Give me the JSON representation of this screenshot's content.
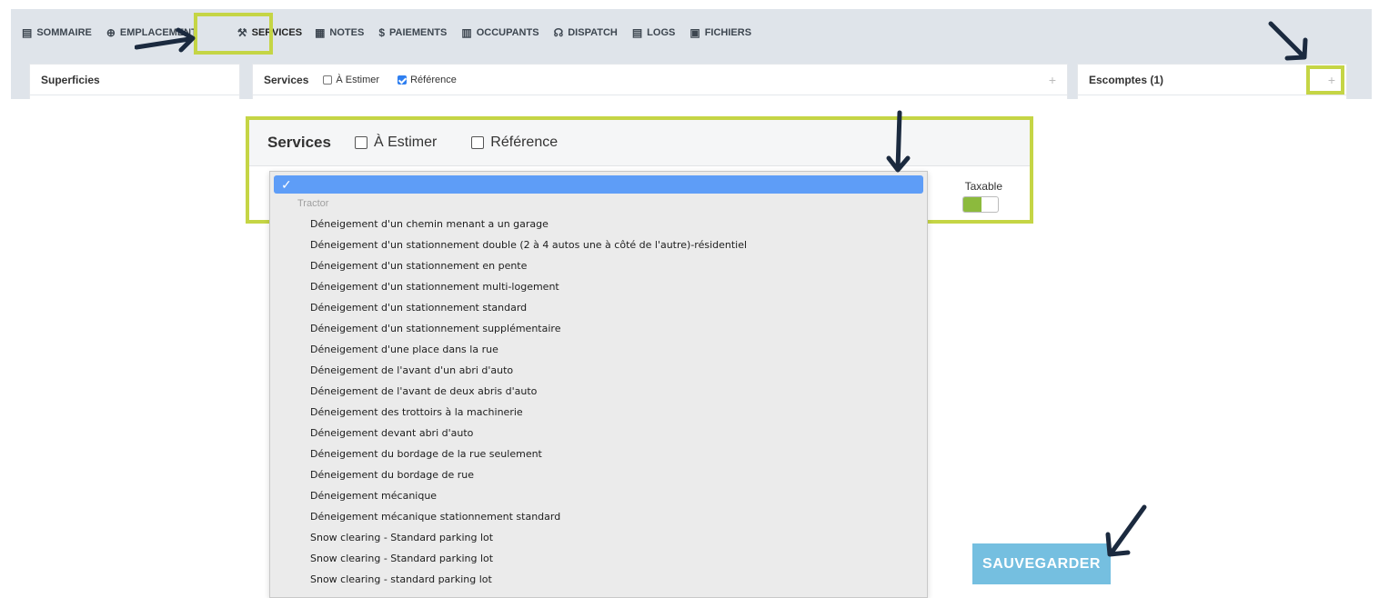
{
  "nav": {
    "items": [
      {
        "label": "SOMMAIRE",
        "icon": "document-icon"
      },
      {
        "label": "EMPLACEMENT",
        "icon": "crosshair-icon"
      },
      {
        "label": "SERVICES",
        "icon": "tools-icon"
      },
      {
        "label": "NOTES",
        "icon": "notes-icon"
      },
      {
        "label": "PAIEMENTS",
        "icon": "dollar-icon"
      },
      {
        "label": "OCCUPANTS",
        "icon": "building-icon"
      },
      {
        "label": "DISPATCH",
        "icon": "headset-icon"
      },
      {
        "label": "LOGS",
        "icon": "clipboard-icon"
      },
      {
        "label": "FICHIERS",
        "icon": "image-folder-icon"
      }
    ],
    "active": "SERVICES"
  },
  "panels": {
    "superficies": {
      "title": "Superficies"
    },
    "services": {
      "title": "Services",
      "estimer_label": "À Estimer",
      "reference_label": "Référence",
      "estimer_checked": false,
      "reference_checked": true
    },
    "escomptes": {
      "title": "Escomptes (1)"
    }
  },
  "zoom": {
    "title": "Services",
    "estimer_label": "À Estimer",
    "reference_label": "Référence",
    "taxable_label": "Taxable"
  },
  "dropdown": {
    "selected_mark": "✓",
    "group_label": "Tractor",
    "options": [
      "Déneigement d'un chemin menant a un garage",
      "Déneigement d'un stationnement double (2 à 4 autos une à côté de l'autre)-résidentiel",
      "Déneigement d'un stationnement en pente",
      "Déneigement d'un stationnement multi-logement",
      "Déneigement d'un stationnement standard",
      "Déneigement d'un stationnement supplémentaire",
      "Déneigement d'une place dans la rue",
      "Déneigement de l'avant d'un abri d'auto",
      "Déneigement de l'avant de deux abris d'auto",
      "Déneigement des trottoirs à la machinerie",
      "Déneigement devant abri d'auto",
      "Déneigement du bordage de la rue seulement",
      "Déneigement du bordage de rue",
      "Déneigement mécanique",
      "Déneigement mécanique stationnement standard",
      "Snow clearing - Standard parking lot",
      "Snow clearing - Standard parking lot",
      "Snow clearing - standard parking lot"
    ]
  },
  "save_button": {
    "label": "SAUVEGARDER"
  },
  "colors": {
    "highlight": "#c5d545",
    "accent": "#5e9df7",
    "save": "#75bfe0",
    "toggle_on": "#8cba3d"
  }
}
